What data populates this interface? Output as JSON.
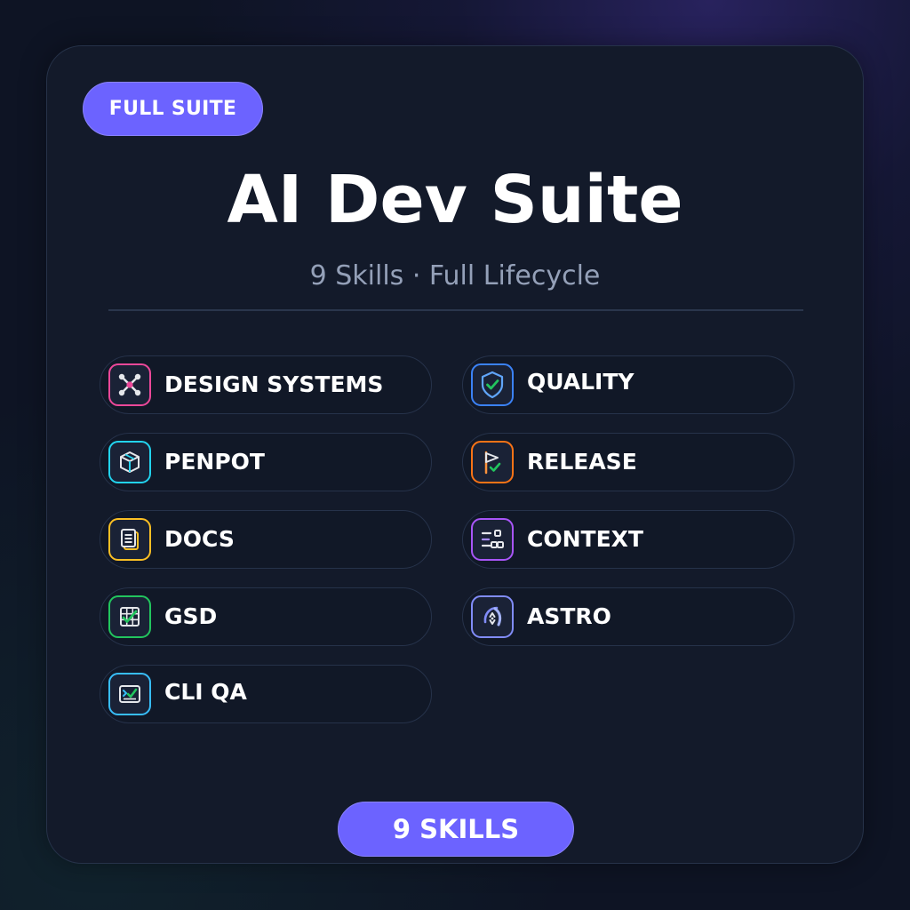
{
  "header": {
    "badge": "FULL SUITE",
    "title": "AI Dev Suite",
    "subtitle": "9 Skills · Full Lifecycle"
  },
  "skills": [
    {
      "label": "DESIGN SYSTEMS",
      "icon": "design-systems-icon",
      "color": "#ec4899"
    },
    {
      "label": "QUALITY",
      "icon": "shield-check-icon",
      "color": "#3b82f6"
    },
    {
      "label": "PENPOT",
      "icon": "cube-icon",
      "color": "#22d3ee"
    },
    {
      "label": "RELEASE",
      "icon": "flag-check-icon",
      "color": "#f97316"
    },
    {
      "label": "DOCS",
      "icon": "document-icon",
      "color": "#fbbf24"
    },
    {
      "label": "CONTEXT",
      "icon": "context-sliders-icon",
      "color": "#a855f7"
    },
    {
      "label": "GSD",
      "icon": "grid-check-icon",
      "color": "#22c55e"
    },
    {
      "label": "ASTRO",
      "icon": "astro-icon",
      "color": "#818cf8"
    },
    {
      "label": "CLI QA",
      "icon": "terminal-check-icon",
      "color": "#38bdf8"
    }
  ],
  "footer": {
    "badge": "9 SKILLS"
  },
  "colors": {
    "accent": "#6c63ff",
    "background": "#0e1424",
    "card": "#131a2a"
  }
}
